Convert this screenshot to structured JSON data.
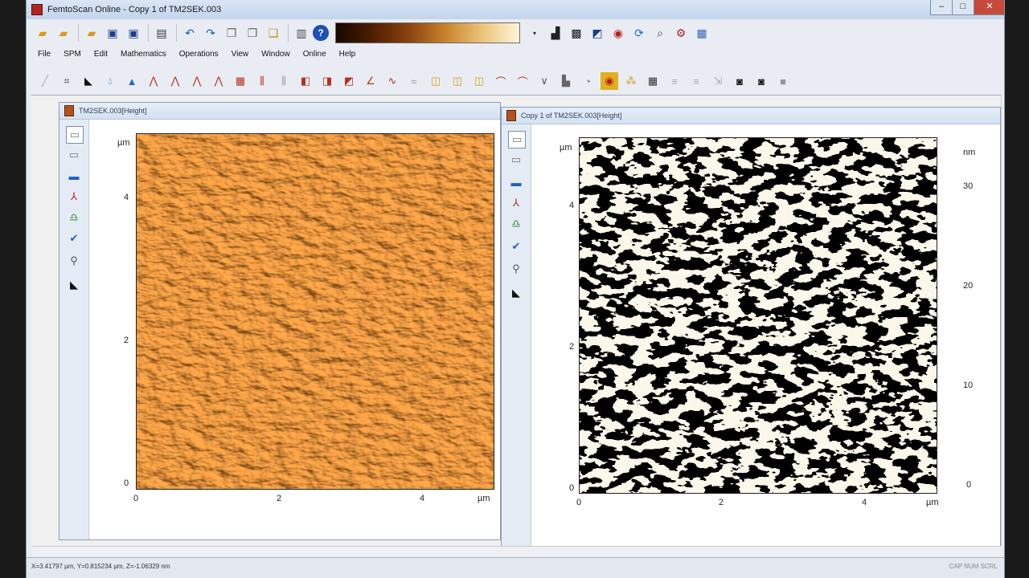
{
  "window": {
    "title": "FemtoScan Online - Copy 1 of TM2SEK.003",
    "min": "–",
    "max": "□",
    "close": "✕"
  },
  "menu": [
    "File",
    "SPM",
    "Edit",
    "Mathematics",
    "Operations",
    "View",
    "Window",
    "Online",
    "Help"
  ],
  "left_panel": {
    "title": "TM2SEK.003[Height]",
    "axis_unit_y": "µm",
    "axis_unit_x": "µm",
    "y_ticks": [
      "4",
      "2",
      "0"
    ],
    "x_ticks": [
      "0",
      "2",
      "4"
    ]
  },
  "right_panel": {
    "title": "Copy 1 of TM2SEK.003[Height]",
    "axis_unit_y": "µm",
    "axis_unit_x": "µm",
    "y_ticks": [
      "4",
      "2",
      "0"
    ],
    "x_ticks": [
      "0",
      "2",
      "4"
    ],
    "scale_unit": "nm",
    "scale_ticks": [
      "30",
      "20",
      "10",
      "0"
    ]
  },
  "status": {
    "coords": "X=3.41797 µm, Y=0.815234 µm, Z=-1.06329 nm",
    "indicators": "CAP  NUM  SCRL"
  },
  "colors": {
    "afm_orange": "#e08a2c",
    "binary_black": "#000000",
    "binary_cream": "#fbf7ea"
  }
}
